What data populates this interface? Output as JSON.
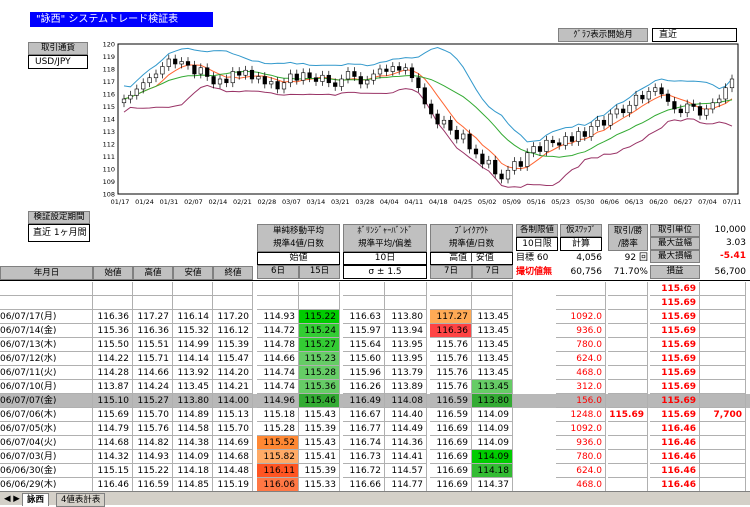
{
  "title": "\"詠西\" システムトレード検証表",
  "graph_start": {
    "label": "ｸﾞﾗﾌ表示開始月",
    "value": "直近"
  },
  "currency": {
    "label": "取引通貨",
    "value": "USD/JPY"
  },
  "period": {
    "label": "検証設定期間",
    "value": "直近 1ヶ月間"
  },
  "chart_data": {
    "type": "line",
    "yticks": [
      108,
      109,
      110,
      111,
      112,
      113,
      114,
      115,
      116,
      117,
      118,
      119,
      120
    ],
    "ylim": [
      108,
      120
    ],
    "xticks": [
      "01/17",
      "01/24",
      "01/31",
      "02/07",
      "02/14",
      "02/21",
      "02/28",
      "03/07",
      "03/14",
      "03/21",
      "03/28",
      "04/04",
      "04/11",
      "04/18",
      "04/25",
      "05/02",
      "05/09",
      "05/16",
      "05/23",
      "05/30",
      "06/06",
      "06/13",
      "06/20",
      "06/27",
      "07/04",
      "07/11"
    ],
    "close": [
      115.6,
      115.9,
      116.4,
      116.9,
      117.3,
      117.6,
      118.2,
      118.8,
      118.4,
      118.6,
      118.3,
      117.6,
      118.1,
      117.4,
      116.8,
      117.2,
      116.9,
      117.8,
      117.5,
      117.9,
      117.2,
      117.4,
      116.8,
      117.0,
      116.4,
      116.9,
      117.6,
      117.1,
      117.7,
      117.3,
      117.0,
      117.5,
      116.9,
      116.6,
      117.2,
      117.8,
      117.4,
      116.8,
      117.1,
      117.6,
      118.0,
      117.8,
      118.2,
      117.9,
      118.1,
      117.3,
      116.5,
      115.2,
      114.4,
      113.6,
      113.9,
      113.1,
      112.4,
      112.8,
      111.6,
      111.2,
      110.4,
      110.7,
      109.6,
      109.2,
      109.9,
      110.6,
      110.2,
      111.3,
      111.8,
      111.4,
      112.3,
      112.1,
      111.9,
      112.6,
      112.2,
      113.0,
      112.6,
      113.4,
      113.9,
      113.5,
      114.4,
      114.8,
      114.5,
      115.1,
      115.9,
      115.6,
      116.2,
      116.5,
      116.0,
      115.4,
      114.8,
      114.5,
      115.2,
      115.0,
      114.3,
      114.8,
      115.3,
      115.6,
      116.5,
      117.2
    ]
  },
  "indicator_headers": [
    {
      "line1": "単純移動平均",
      "line2": "規準4値/日数",
      "sub": "始値",
      "a": "6日",
      "b": "15日"
    },
    {
      "line1": "ﾎﾞﾘﾝｼﾞｬｰﾊﾞﾝﾄﾞ",
      "line2": "規準平均/偏差",
      "sub": "10日",
      "a": "σ ± 1.5",
      "b": ""
    },
    {
      "line1": "ﾌﾞﾚｲｸｱｳﾄ",
      "line2": "規準値/日数",
      "sub": "高值 | 安值",
      "a": "7日",
      "b": "7日"
    }
  ],
  "limit": {
    "label": "各制限値",
    "row1": "10日限",
    "row2a": "目標",
    "row2b": "60",
    "row3": "撮切値無"
  },
  "swap": {
    "label": "仮ｽﾜｯﾌﾟ",
    "row1": "計算",
    "row2": "4,056",
    "row3": "60,756"
  },
  "stats": {
    "c1": "取引/勝",
    "c2": "/勝率",
    "v_count": "92",
    "v_unit": "回",
    "v_rate": "71.70%"
  },
  "unit": {
    "l1": "取引単位",
    "v1": "10,000",
    "l2": "最大益幅",
    "v2": "3.03",
    "l3": "最大損幅",
    "v3": "-5.41",
    "l4": "損益",
    "v4": "56,700"
  },
  "columns": [
    "年月日",
    "始値",
    "高値",
    "安値",
    "終値"
  ],
  "rows": [
    {
      "date": "",
      "o": "",
      "h": "",
      "l": "",
      "c": "",
      "s6": "",
      "s15": "",
      "bh": "",
      "bl": "",
      "k7": "",
      "k7b": "",
      "sw": "",
      "e1": "",
      "e2": "115.69",
      "pl": ""
    },
    {
      "date": "",
      "o": "",
      "h": "",
      "l": "",
      "c": "",
      "s6": "",
      "s15": "",
      "bh": "",
      "bl": "",
      "k7": "",
      "k7b": "",
      "sw": "",
      "e1": "",
      "e2": "115.69",
      "pl": ""
    },
    {
      "date": "06/07/17(月)",
      "o": "116.36",
      "h": "117.27",
      "l": "116.14",
      "c": "117.20",
      "s6": "114.93",
      "s15": "115.22",
      "bh": "116.63",
      "bl": "113.80",
      "k7": "117.27",
      "k7b": "113.45",
      "sw": "1092.0",
      "e1": "",
      "e2": "115.69",
      "pl": ""
    },
    {
      "date": "06/07/14(金)",
      "o": "115.36",
      "h": "116.36",
      "l": "115.32",
      "c": "116.12",
      "s6": "114.72",
      "s15": "115.24",
      "bh": "115.97",
      "bl": "113.94",
      "k7": "116.36",
      "k7b": "113.45",
      "sw": "936.0",
      "e1": "",
      "e2": "115.69",
      "pl": ""
    },
    {
      "date": "06/07/13(木)",
      "o": "115.50",
      "h": "115.51",
      "l": "114.99",
      "c": "115.39",
      "s6": "114.78",
      "s15": "115.27",
      "bh": "115.64",
      "bl": "113.95",
      "k7": "115.76",
      "k7b": "113.45",
      "sw": "780.0",
      "e1": "",
      "e2": "115.69",
      "pl": ""
    },
    {
      "date": "06/07/12(水)",
      "o": "114.22",
      "h": "115.71",
      "l": "114.14",
      "c": "115.47",
      "s6": "114.66",
      "s15": "115.23",
      "bh": "115.60",
      "bl": "113.95",
      "k7": "115.76",
      "k7b": "113.45",
      "sw": "624.0",
      "e1": "",
      "e2": "115.69",
      "pl": ""
    },
    {
      "date": "06/07/11(火)",
      "o": "114.28",
      "h": "114.66",
      "l": "113.92",
      "c": "114.20",
      "s6": "114.74",
      "s15": "115.28",
      "bh": "115.96",
      "bl": "113.79",
      "k7": "115.76",
      "k7b": "113.45",
      "sw": "468.0",
      "e1": "",
      "e2": "115.69",
      "pl": ""
    },
    {
      "date": "06/07/10(月)",
      "o": "113.87",
      "h": "114.24",
      "l": "113.45",
      "c": "114.21",
      "s6": "114.74",
      "s15": "115.36",
      "bh": "116.26",
      "bl": "113.89",
      "k7": "115.76",
      "k7b": "113.45",
      "sw": "312.0",
      "e1": "",
      "e2": "115.69",
      "pl": ""
    },
    {
      "date": "06/07/07(金)",
      "o": "115.10",
      "h": "115.27",
      "l": "113.80",
      "c": "114.00",
      "s6": "114.96",
      "s15": "115.46",
      "bh": "116.49",
      "bl": "114.08",
      "k7": "116.59",
      "k7b": "113.80",
      "sw": "156.0",
      "e1": "",
      "e2": "115.69",
      "pl": ""
    },
    {
      "date": "06/07/06(木)",
      "o": "115.69",
      "h": "115.70",
      "l": "114.89",
      "c": "115.13",
      "s6": "115.18",
      "s15": "115.43",
      "bh": "116.67",
      "bl": "114.40",
      "k7": "116.59",
      "k7b": "114.09",
      "sw": "1248.0",
      "e1": "115.69",
      "e2": "115.69",
      "pl": "7,700"
    },
    {
      "date": "06/07/05(水)",
      "o": "114.79",
      "h": "115.76",
      "l": "114.58",
      "c": "115.70",
      "s6": "115.28",
      "s15": "115.39",
      "bh": "116.77",
      "bl": "114.49",
      "k7": "116.69",
      "k7b": "114.09",
      "sw": "1092.0",
      "e1": "",
      "e2": "116.46",
      "pl": ""
    },
    {
      "date": "06/07/04(火)",
      "o": "114.68",
      "h": "114.82",
      "l": "114.38",
      "c": "114.69",
      "s6": "115.52",
      "s15": "115.43",
      "bh": "116.74",
      "bl": "114.36",
      "k7": "116.69",
      "k7b": "114.09",
      "sw": "936.0",
      "e1": "",
      "e2": "116.46",
      "pl": ""
    },
    {
      "date": "06/07/03(月)",
      "o": "114.32",
      "h": "114.93",
      "l": "114.09",
      "c": "114.68",
      "s6": "115.82",
      "s15": "115.41",
      "bh": "116.73",
      "bl": "114.41",
      "k7": "116.69",
      "k7b": "114.09",
      "sw": "780.0",
      "e1": "",
      "e2": "116.46",
      "pl": ""
    },
    {
      "date": "06/06/30(金)",
      "o": "115.15",
      "h": "115.22",
      "l": "114.18",
      "c": "114.48",
      "s6": "116.11",
      "s15": "115.39",
      "bh": "116.72",
      "bl": "114.57",
      "k7": "116.69",
      "k7b": "114.18",
      "sw": "624.0",
      "e1": "",
      "e2": "116.46",
      "pl": ""
    },
    {
      "date": "06/06/29(木)",
      "o": "116.46",
      "h": "116.59",
      "l": "114.85",
      "c": "115.19",
      "s6": "116.06",
      "s15": "115.33",
      "bh": "116.66",
      "bl": "114.77",
      "k7": "116.69",
      "k7b": "114.37",
      "sw": "468.0",
      "e1": "",
      "e2": "116.46",
      "pl": ""
    }
  ],
  "tabs": [
    "詠西",
    "4値表計表"
  ]
}
